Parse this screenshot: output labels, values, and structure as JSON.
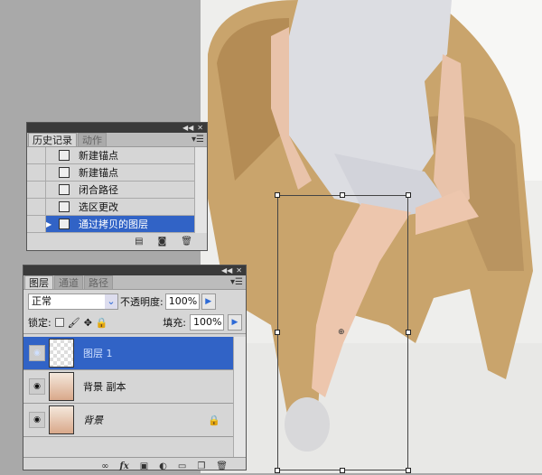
{
  "history_panel": {
    "tabs": [
      "历史记录",
      "动作"
    ],
    "items": [
      {
        "label": "新建锚点"
      },
      {
        "label": "新建锚点"
      },
      {
        "label": "闭合路径"
      },
      {
        "label": "选区更改"
      },
      {
        "label": "通过拷贝的图层",
        "selected": true
      }
    ]
  },
  "layers_panel": {
    "tabs": [
      "图层",
      "通道",
      "路径"
    ],
    "blend_mode": "正常",
    "opacity_label": "不透明度:",
    "opacity": "100%",
    "lock_label": "锁定:",
    "fill_label": "填充:",
    "fill": "100%",
    "layers": [
      {
        "name": "图层 1",
        "selected": true
      },
      {
        "name": "背景 副本"
      },
      {
        "name": "背景",
        "locked": true
      }
    ],
    "footer_fx": "fx"
  },
  "colors": {
    "selection": "#3163c6",
    "panel": "#d6d6d6"
  }
}
